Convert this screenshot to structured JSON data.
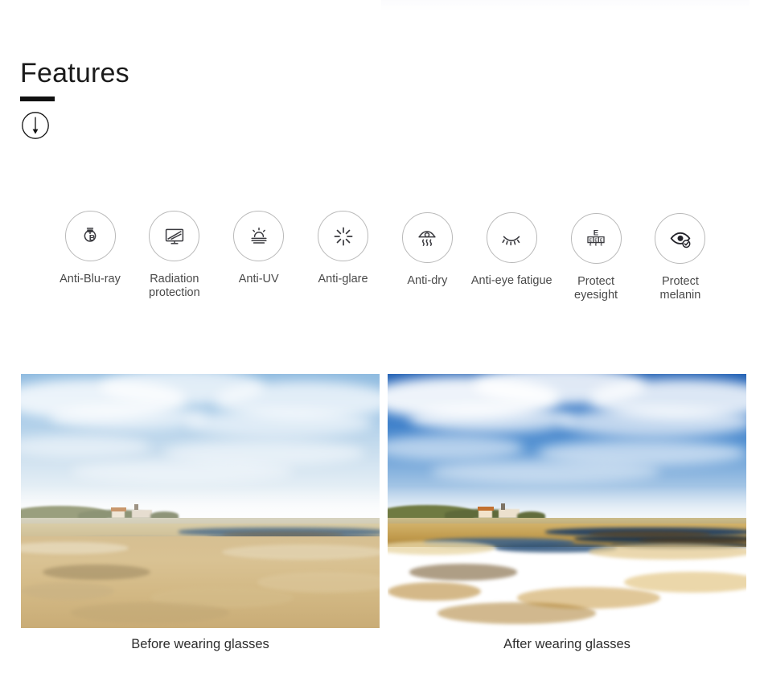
{
  "heading": {
    "title": "Features",
    "scroll_icon": "circle-down-arrow-icon"
  },
  "features": [
    {
      "label": "Anti-Blu-ray",
      "icon": "lightbulb-b-icon",
      "offset": "off-1"
    },
    {
      "label": "Radiation\nprotection",
      "icon": "monitor-screen-icon",
      "offset": "off-1"
    },
    {
      "label": "Anti-UV",
      "icon": "sun-horizon-icon",
      "offset": "off-1"
    },
    {
      "label": "Anti-glare",
      "icon": "glare-burst-icon",
      "offset": "off-1"
    },
    {
      "label": "Anti-dry",
      "icon": "dry-eye-drip-icon",
      "offset": "off-2"
    },
    {
      "label": "Anti-eye fatigue",
      "icon": "closed-eye-lashes-icon",
      "offset": "off-2"
    },
    {
      "label": "Protect\neyesight",
      "icon": "eye-chart-icon",
      "offset": "off-3"
    },
    {
      "label": "Protect\nmelanin",
      "icon": "eye-check-icon",
      "offset": "off-3"
    }
  ],
  "comparison": {
    "before": {
      "caption": "Before wearing glasses",
      "alt": "Marshland landscape with reeds, tidal channels and a distant farmhouse, low contrast and washed out"
    },
    "after": {
      "caption": "After wearing glasses",
      "alt": "Same marshland landscape with deeper blue sky and richer golden reeds, higher contrast and saturation"
    }
  },
  "colors": {
    "heading_text": "#1b1b1b",
    "rule": "#111111",
    "circle_stroke": "#b9b9b9",
    "icon_stroke": "#3a3a3f",
    "label_text": "#4a4a4a",
    "caption_text": "#2e2e2e",
    "sky_before": "#9ec4e4",
    "sky_after": "#2e6fc0",
    "reeds_before": "#d9c08d",
    "reeds_after": "#c08a36"
  }
}
